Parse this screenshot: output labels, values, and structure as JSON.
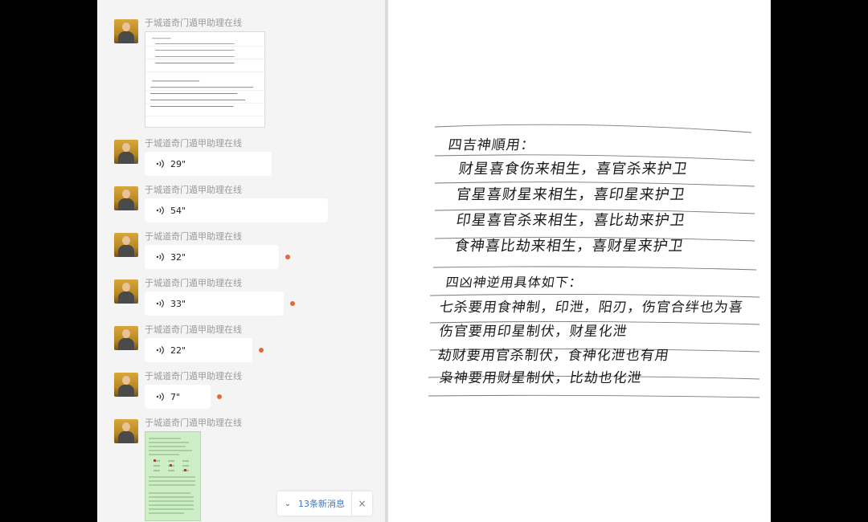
{
  "chat": {
    "sender_name": "于城道奇门遁甲助理在线",
    "voice_messages": [
      {
        "duration": "29\"",
        "unread": false
      },
      {
        "duration": "54\"",
        "unread": false
      },
      {
        "duration": "32\"",
        "unread": true
      },
      {
        "duration": "33\"",
        "unread": true
      },
      {
        "duration": "22\"",
        "unread": true
      },
      {
        "duration": "7\"",
        "unread": true
      }
    ],
    "new_messages_label": "13条新消息"
  },
  "viewer": {
    "section1": {
      "heading": "四吉神順用：",
      "lines": [
        "财星喜食伤来相生，喜官杀来护卫",
        "官星喜财星来相生，喜印星来护卫",
        "印星喜官杀来相生，喜比劫来护卫",
        "食神喜比劫来相生，喜财星来护卫"
      ]
    },
    "section2": {
      "heading": "四凶神逆用具体如下：",
      "lines": [
        "七杀要用食神制，印泄，阳刃，伤官合绊也为喜",
        "伤官要用印星制伏，财星化泄",
        "劫财要用官杀制伏，食神化泄也有用",
        "枭神要用财星制伏，比劫也化泄"
      ]
    }
  },
  "colors": {
    "accent_link": "#3f79c2",
    "unread_dot": "#e06a3b",
    "chat_bg": "#f4f4f4"
  }
}
